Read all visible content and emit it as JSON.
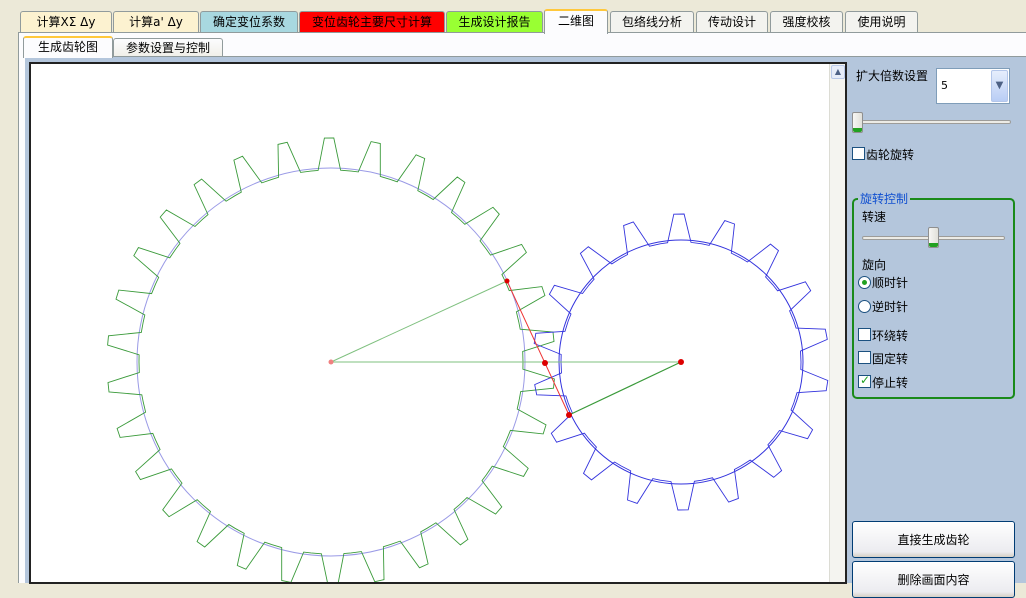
{
  "top_tabs": [
    {
      "label": "计算XΣ  Δy",
      "bg": "#fcf2d0"
    },
    {
      "label": "计算a'  Δy",
      "bg": "#fcf2d0"
    },
    {
      "label": "确定变位系数",
      "bg": "#a8d8e0"
    },
    {
      "label": "变位齿轮主要尺寸计算",
      "bg": "#ff0000"
    },
    {
      "label": "生成设计报告",
      "bg": "#99ff33"
    },
    {
      "label": "二维图",
      "bg": "#fcfcfe"
    },
    {
      "label": "包络线分析",
      "bg": "#f3f3ef"
    },
    {
      "label": "传动设计",
      "bg": "#f3f3ef"
    },
    {
      "label": "强度校核",
      "bg": "#f3f3ef"
    },
    {
      "label": "使用说明",
      "bg": "#f3f3ef"
    }
  ],
  "active_top_tab": "二维图",
  "sub_tabs": [
    {
      "label": "生成齿轮图"
    },
    {
      "label": "参数设置与控制"
    }
  ],
  "active_sub_tab": "生成齿轮图",
  "controls": {
    "zoom_label": "扩大倍数设置",
    "zoom_value": "5",
    "zoom_slider_level": 0,
    "gear_rotate_label": "齿轮旋转",
    "gear_rotate_checked": false,
    "rotation_group_title": "旋转控制",
    "speed_label": "转速",
    "speed_slider_level": 0.5,
    "direction_label": "旋向",
    "clockwise_label": "顺时针",
    "counterclockwise_label": "逆时针",
    "direction_selected": "clockwise",
    "orbit_label": "环绕转",
    "orbit_checked": false,
    "fixed_label": "固定转",
    "fixed_checked": false,
    "stop_label": "停止转",
    "stop_checked": true,
    "generate_button": "直接生成齿轮",
    "clear_button": "删除画面内容"
  },
  "colors": {
    "large_gear": "#3a9a3a",
    "small_gear": "#3333dd",
    "pitch_circle_large": "#9a9ae6",
    "pitch_circle_small": "#3333dd",
    "center_line": "#7fc07f",
    "line_of_action": "#ee3333",
    "contact_point": "#dd0000"
  }
}
